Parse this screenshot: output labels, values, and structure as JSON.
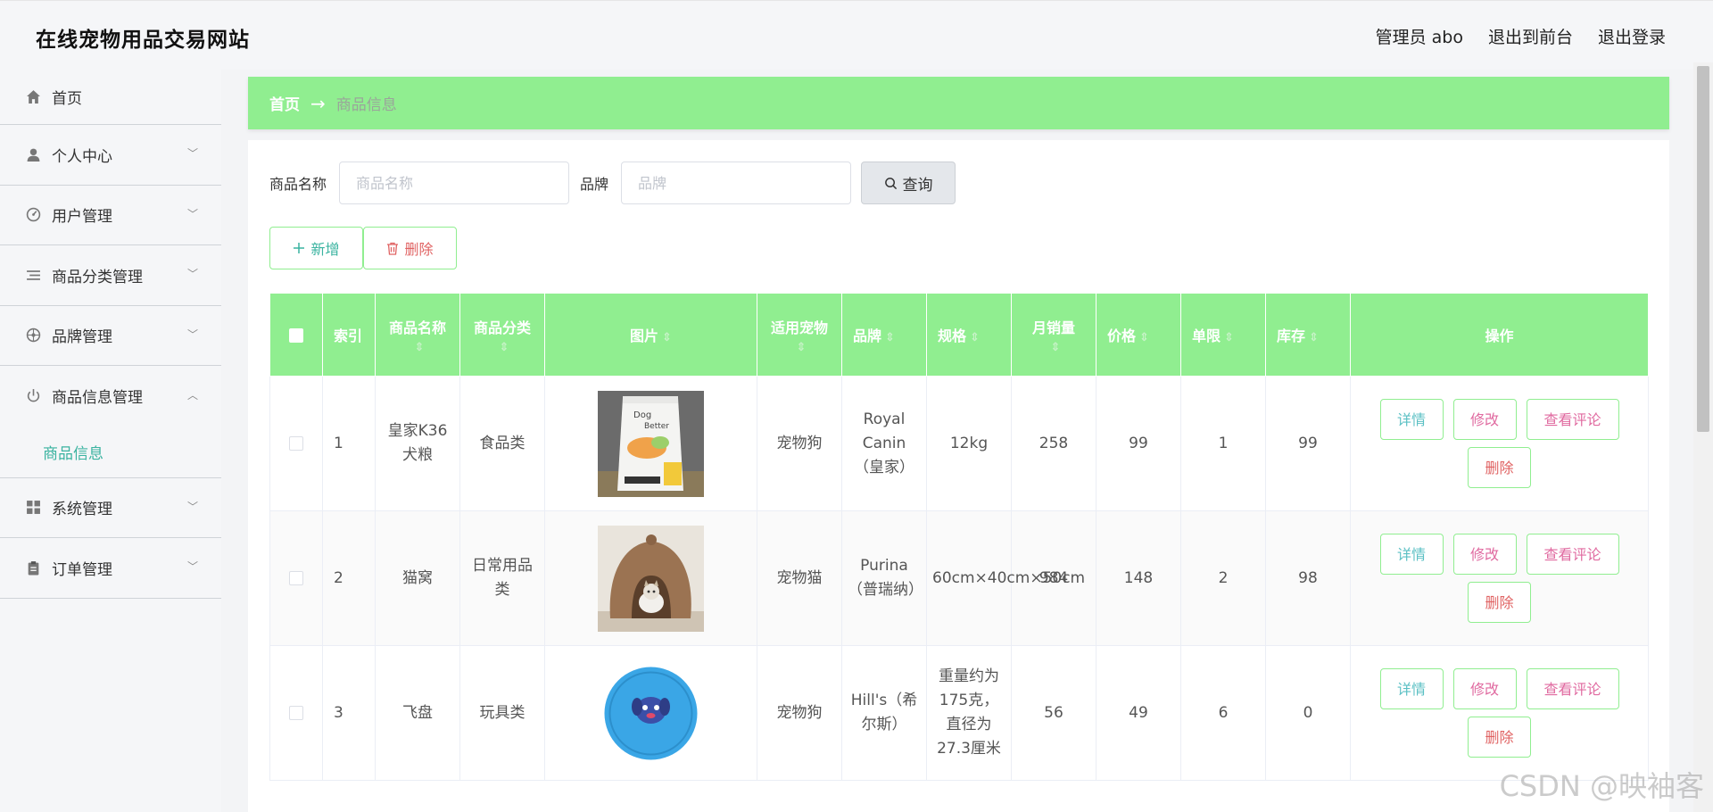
{
  "header": {
    "title": "在线宠物用品交易网站",
    "admin": "管理员 abo",
    "to_front": "退出到前台",
    "logout": "退出登录"
  },
  "sidebar": {
    "items": [
      {
        "label": "首页",
        "icon": "home-icon"
      },
      {
        "label": "个人中心",
        "icon": "user-icon"
      },
      {
        "label": "用户管理",
        "icon": "gauge-icon"
      },
      {
        "label": "商品分类管理",
        "icon": "list-icon"
      },
      {
        "label": "品牌管理",
        "icon": "compass-icon"
      },
      {
        "label": "商品信息管理",
        "icon": "power-icon"
      },
      {
        "label": "系统管理",
        "icon": "grid-icon"
      },
      {
        "label": "订单管理",
        "icon": "clipboard-icon"
      }
    ],
    "submenu_active": "商品信息"
  },
  "breadcrumb": {
    "home": "首页",
    "arrow": "→",
    "current": "商品信息"
  },
  "search": {
    "name_label": "商品名称",
    "name_placeholder": "商品名称",
    "brand_label": "品牌",
    "brand_placeholder": "品牌",
    "query_label": "查询"
  },
  "actions": {
    "add_label": "新增",
    "delete_label": "删除"
  },
  "table": {
    "headers": [
      "索引",
      "商品名称",
      "商品分类",
      "图片",
      "适用宠物",
      "品牌",
      "规格",
      "月销量",
      "价格",
      "单限",
      "库存",
      "操作"
    ],
    "ops": {
      "detail": "详情",
      "edit": "修改",
      "comment": "查看评论",
      "delete": "删除"
    },
    "rows": [
      {
        "index": "1",
        "name": "皇家K36犬粮",
        "category": "食品类",
        "image": "dog-food-bag",
        "pet": "宠物狗",
        "brand": "Royal Canin（皇家）",
        "spec": "12kg",
        "sales": "258",
        "price": "99",
        "limit": "1",
        "stock": "99"
      },
      {
        "index": "2",
        "name": "猫窝",
        "category": "日常用品类",
        "image": "cat-bed",
        "pet": "宠物猫",
        "brand": "Purina（普瑞纳）",
        "spec": "60cm×40cm×50cm",
        "sales": "984",
        "price": "148",
        "limit": "2",
        "stock": "98"
      },
      {
        "index": "3",
        "name": "飞盘",
        "category": "玩具类",
        "image": "frisbee",
        "pet": "宠物狗",
        "brand": "Hill's（希尔斯）",
        "spec": "重量约为175克，直径为27.3厘米",
        "sales": "56",
        "price": "49",
        "limit": "6",
        "stock": "0"
      }
    ]
  },
  "watermark": "CSDN @映袖客",
  "colors": {
    "accent_green": "#90ee90",
    "teal": "#3ab3a0",
    "pink": "#e06aa0",
    "red": "#e06363"
  }
}
